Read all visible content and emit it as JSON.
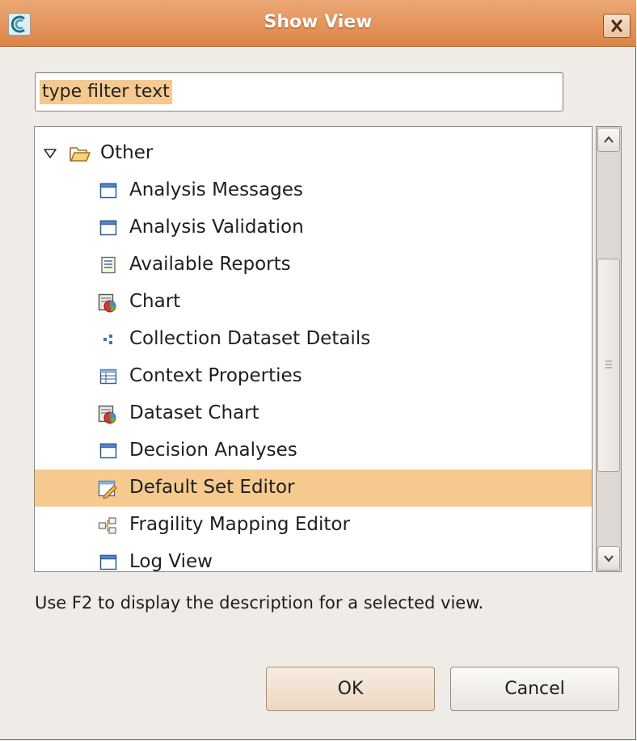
{
  "dialog": {
    "title": "Show View",
    "filter": {
      "value": "type filter text",
      "placeholder": "type filter text"
    },
    "tree": {
      "category": {
        "label": "Other",
        "expanded": true,
        "icon": "folder-open-icon"
      },
      "items": [
        {
          "label": "Analysis Messages",
          "icon": "view-window-icon"
        },
        {
          "label": "Analysis Validation",
          "icon": "view-window-icon"
        },
        {
          "label": "Available Reports",
          "icon": "report-icon"
        },
        {
          "label": "Chart",
          "icon": "chart-icon"
        },
        {
          "label": "Collection Dataset Details",
          "icon": "dataset-details-icon"
        },
        {
          "label": "Context Properties",
          "icon": "properties-table-icon"
        },
        {
          "label": "Dataset Chart",
          "icon": "chart-icon"
        },
        {
          "label": "Decision Analyses",
          "icon": "view-window-icon"
        },
        {
          "label": "Default Set Editor",
          "icon": "editor-pencil-icon",
          "selected": true
        },
        {
          "label": "Fragility Mapping Editor",
          "icon": "mapping-icon"
        },
        {
          "label": "Log View",
          "icon": "view-window-icon"
        }
      ]
    },
    "hint": "Use F2 to display the description for a selected view.",
    "buttons": {
      "ok": "OK",
      "cancel": "Cancel"
    },
    "colors": {
      "titlebar": "#e59860",
      "selection": "#f6ca8f",
      "filter_highlight": "#f5c98f",
      "background": "#efebe7"
    }
  }
}
